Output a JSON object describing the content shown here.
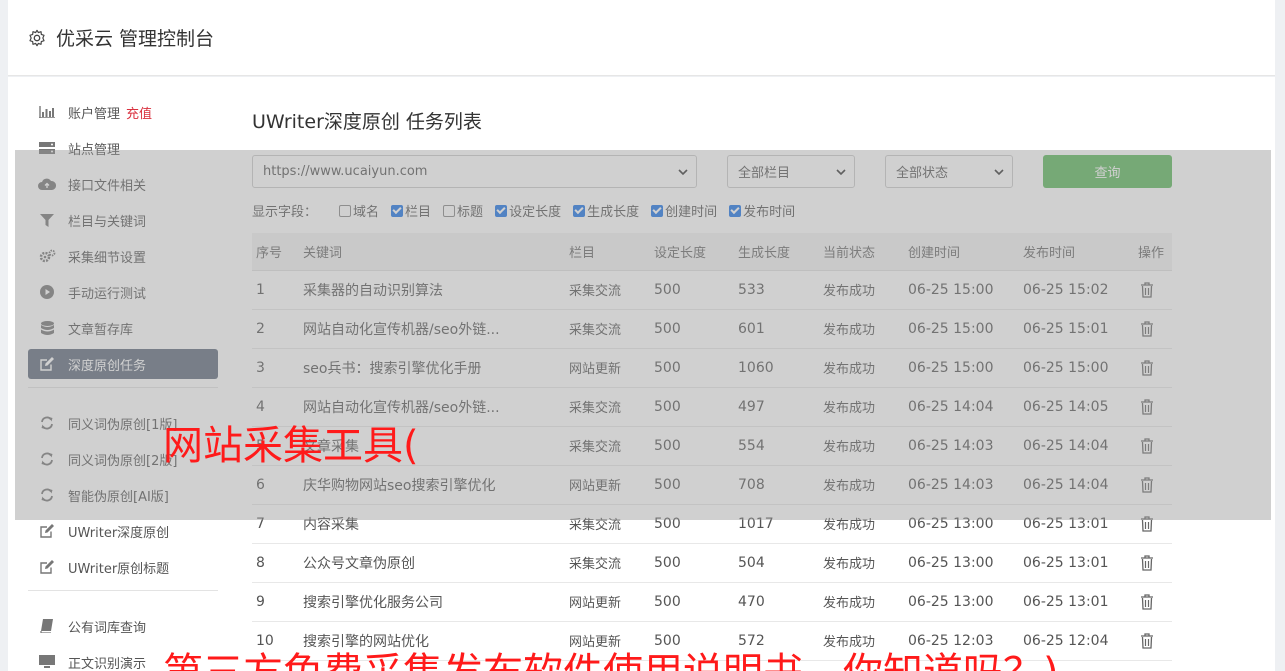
{
  "header": {
    "title": "优采云 管理控制台"
  },
  "sidebar": {
    "items": [
      {
        "label": "账户管理",
        "extra": "充值",
        "icon": "bar-chart-icon"
      },
      {
        "label": "站点管理",
        "icon": "server-icon"
      },
      {
        "label": "接口文件相关",
        "icon": "cloud-upload-icon"
      },
      {
        "label": "栏目与关键词",
        "icon": "filter-icon"
      },
      {
        "label": "采集细节设置",
        "icon": "cogs-icon"
      },
      {
        "label": "手动运行测试",
        "icon": "play-circle-icon"
      },
      {
        "label": "文章暂存库",
        "icon": "database-icon"
      },
      {
        "label": "深度原创任务",
        "icon": "edit-icon",
        "active": true
      }
    ],
    "items2": [
      {
        "label": "同义词伪原创[1版]",
        "icon": "refresh-icon"
      },
      {
        "label": "同义词伪原创[2版]",
        "icon": "refresh-icon"
      },
      {
        "label": "智能伪原创[AI版]",
        "icon": "refresh-icon"
      },
      {
        "label": "UWriter深度原创",
        "icon": "edit-icon"
      },
      {
        "label": "UWriter原创标题",
        "icon": "edit-icon"
      }
    ],
    "items3": [
      {
        "label": "公有词库查询",
        "icon": "book-icon"
      },
      {
        "label": "正文识别演示",
        "icon": "monitor-icon"
      }
    ]
  },
  "main": {
    "title": "UWriter深度原创 任务列表",
    "site_select": "https://www.ucaiyun.com",
    "column_select": "全部栏目",
    "status_select": "全部状态",
    "query_button": "查询",
    "fields_label": "显示字段：",
    "fields": [
      {
        "label": "域名",
        "checked": false
      },
      {
        "label": "栏目",
        "checked": true
      },
      {
        "label": "标题",
        "checked": false
      },
      {
        "label": "设定长度",
        "checked": true
      },
      {
        "label": "生成长度",
        "checked": true
      },
      {
        "label": "创建时间",
        "checked": true
      },
      {
        "label": "发布时间",
        "checked": true
      }
    ],
    "table": {
      "headers": [
        "序号",
        "关键词",
        "栏目",
        "设定长度",
        "生成长度",
        "当前状态",
        "创建时间",
        "发布时间",
        "操作"
      ],
      "rows": [
        [
          "1",
          "采集器的自动识别算法",
          "采集交流",
          "500",
          "533",
          "发布成功",
          "06-25 15:00",
          "06-25 15:02"
        ],
        [
          "2",
          "网站自动化宣传机器/seo外链...",
          "采集交流",
          "500",
          "601",
          "发布成功",
          "06-25 15:00",
          "06-25 15:01"
        ],
        [
          "3",
          "seo兵书：搜索引擎优化手册",
          "网站更新",
          "500",
          "1060",
          "发布成功",
          "06-25 15:00",
          "06-25 15:00"
        ],
        [
          "4",
          "网站自动化宣传机器/seo外链...",
          "采集交流",
          "500",
          "497",
          "发布成功",
          "06-25 14:04",
          "06-25 14:05"
        ],
        [
          "5",
          "文章采集",
          "采集交流",
          "500",
          "554",
          "发布成功",
          "06-25 14:03",
          "06-25 14:04"
        ],
        [
          "6",
          "庆华购物网站seo搜索引擎优化",
          "网站更新",
          "500",
          "708",
          "发布成功",
          "06-25 14:03",
          "06-25 14:04"
        ],
        [
          "7",
          "内容采集",
          "采集交流",
          "500",
          "1017",
          "发布成功",
          "06-25 13:00",
          "06-25 13:01"
        ],
        [
          "8",
          "公众号文章伪原创",
          "采集交流",
          "500",
          "504",
          "发布成功",
          "06-25 13:00",
          "06-25 13:01"
        ],
        [
          "9",
          "搜索引擎优化服务公司",
          "网站更新",
          "500",
          "470",
          "发布成功",
          "06-25 13:00",
          "06-25 13:01"
        ],
        [
          "10",
          "搜索引擎的网站优化",
          "网站更新",
          "500",
          "572",
          "发布成功",
          "06-25 12:03",
          "06-25 12:04"
        ]
      ]
    }
  },
  "overlay": {
    "text1": "网站采集工具(",
    "text2": "第三方免费采集发布软件使用说明书，你知道吗？)"
  },
  "colors": {
    "accent": "#5f6b7c",
    "query": "#5cb85c",
    "success": "#3c9a3c",
    "highlight": "#d9303e",
    "ad": "#ff1a1a"
  }
}
